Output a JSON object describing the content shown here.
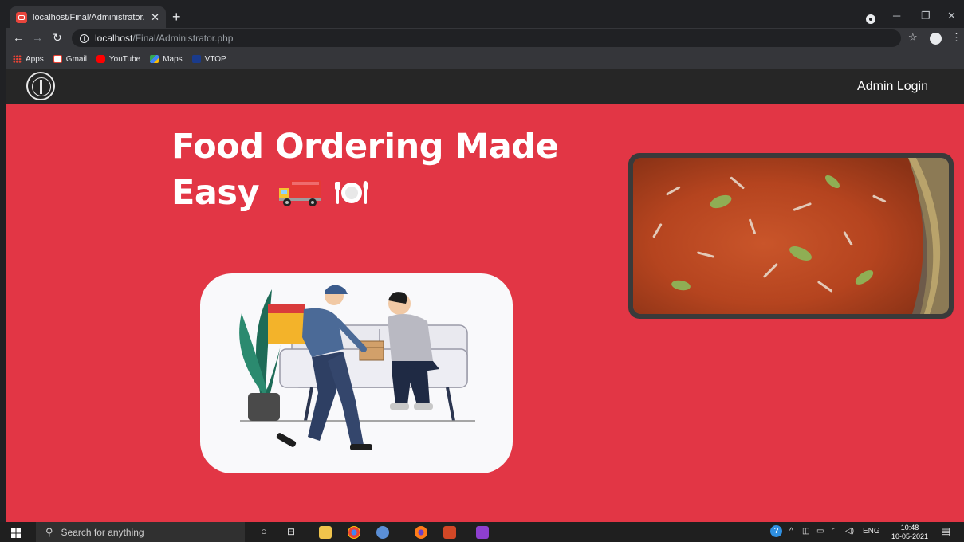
{
  "browser": {
    "tab_title": "localhost/Final/Administrator.ph",
    "url_host": "localhost",
    "url_path": "/Final/Administrator.php",
    "bookmarks": [
      {
        "label": "Apps",
        "icon": "apps-grid-icon",
        "color": "#ea4335"
      },
      {
        "label": "Gmail",
        "icon": "gmail-icon",
        "color": "#ea4335"
      },
      {
        "label": "YouTube",
        "icon": "youtube-icon",
        "color": "#ff0000"
      },
      {
        "label": "Maps",
        "icon": "maps-icon",
        "color": "#34a853"
      },
      {
        "label": "VTOP",
        "icon": "vtop-icon",
        "color": "#1a3b8c"
      }
    ]
  },
  "site": {
    "nav_login": "Admin Login",
    "hero_line1": "Food Ordering Made",
    "hero_line2": "Easy",
    "colors": {
      "brand": "#e23645",
      "navbar": "#262626",
      "card": "#f9f9fb"
    }
  },
  "taskbar": {
    "search_placeholder": "Search for anything",
    "lang": "ENG",
    "time": "10:48",
    "date": "10-05-2021"
  }
}
